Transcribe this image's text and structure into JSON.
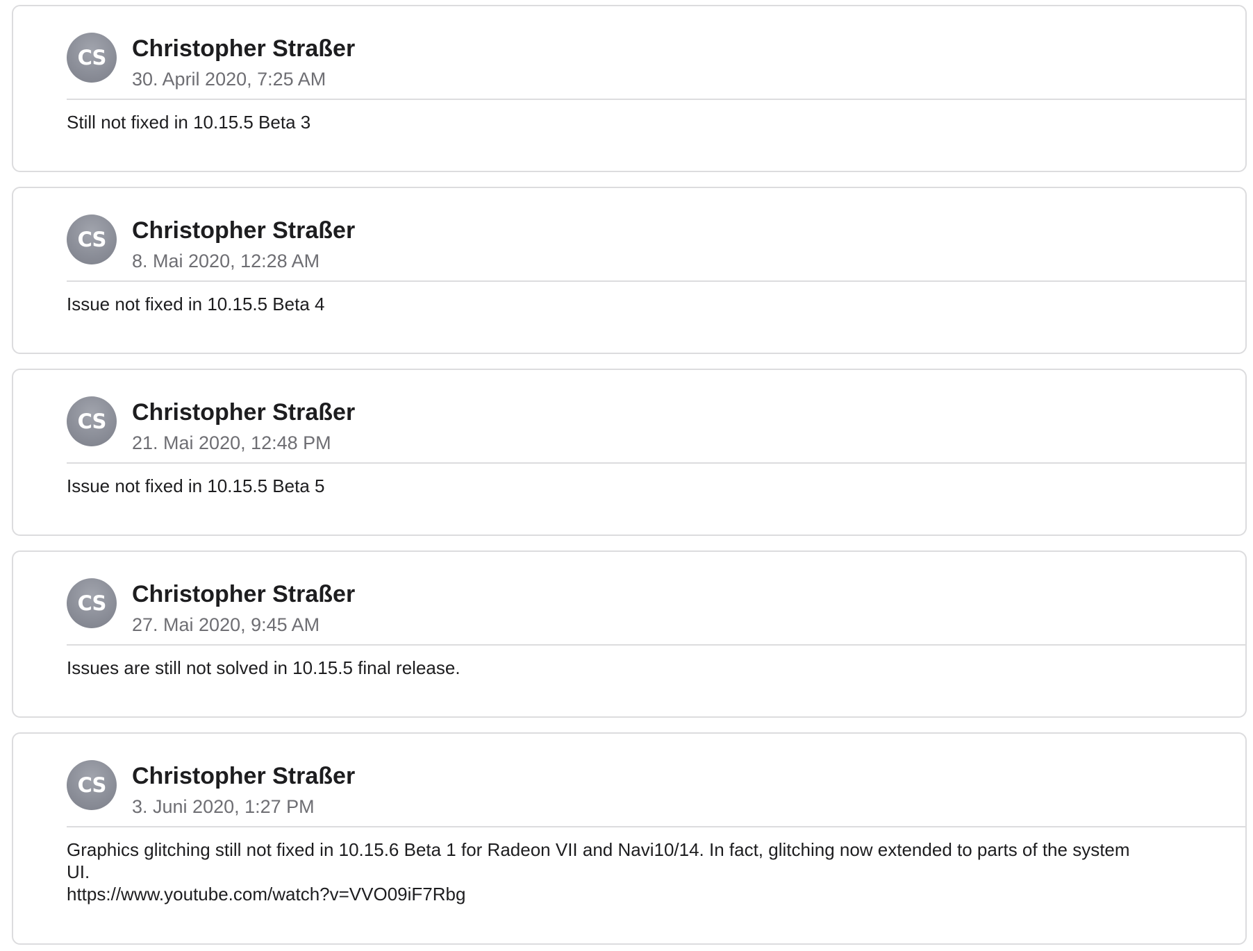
{
  "comments": [
    {
      "avatar_initials": "CS",
      "author": "Christopher Straßer",
      "date": "30. April 2020, 7:25 AM",
      "text": "Still not fixed in 10.15.5 Beta 3"
    },
    {
      "avatar_initials": "CS",
      "author": "Christopher Straßer",
      "date": "8. Mai 2020, 12:28 AM",
      "text": "Issue not fixed in 10.15.5 Beta 4"
    },
    {
      "avatar_initials": "CS",
      "author": "Christopher Straßer",
      "date": "21. Mai 2020, 12:48 PM",
      "text": "Issue not fixed in 10.15.5 Beta 5"
    },
    {
      "avatar_initials": "CS",
      "author": "Christopher Straßer",
      "date": "27. Mai 2020, 9:45 AM",
      "text": "Issues are still not solved in 10.15.5 final release."
    },
    {
      "avatar_initials": "CS",
      "author": "Christopher Straßer",
      "date": "3. Juni 2020, 1:27 PM",
      "text_line1": "Graphics glitching still not fixed in 10.15.6 Beta 1 for Radeon VII and Navi10/14. In fact, glitching now extended to parts of the system UI.",
      "link": "https://www.youtube.com/watch?v=VVO09iF7Rbg"
    }
  ]
}
